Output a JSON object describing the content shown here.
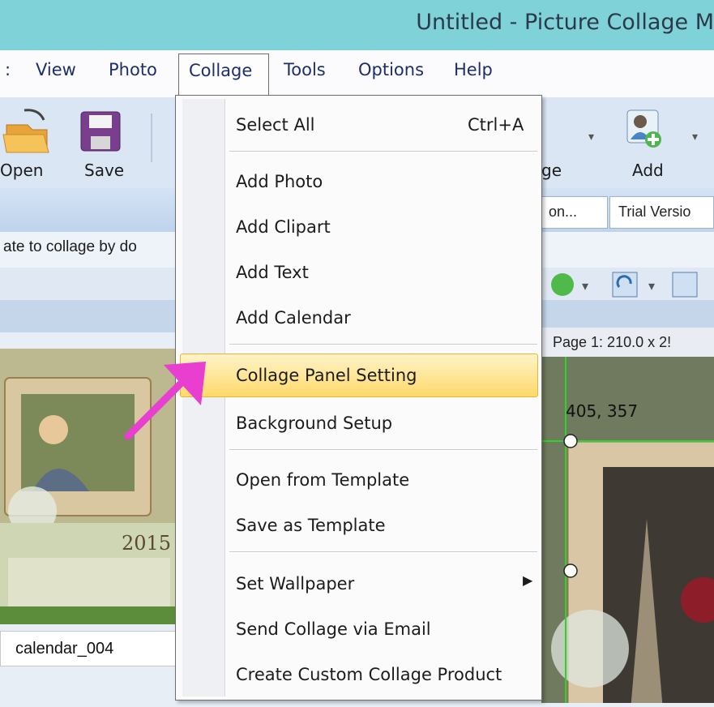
{
  "window": {
    "title": "Untitled - Picture Collage M"
  },
  "menubar": {
    "items": [
      ":",
      "View",
      "Photo",
      "Collage",
      "Tools",
      "Options",
      "Help"
    ]
  },
  "toolbar": {
    "open": "Open",
    "save": "Save",
    "change": "ge",
    "add": "Add"
  },
  "bar2": {
    "option": "on...",
    "trial": "Trial Versio"
  },
  "hint": "ate to collage by do",
  "page_info": "Page 1: 210.0 x 2!",
  "coords": "405, 357",
  "thumbnail": {
    "year": "2015",
    "caption": "calendar_004"
  },
  "collage_menu": {
    "select_all": "Select All",
    "select_all_shortcut": "Ctrl+A",
    "add_photo": "Add Photo",
    "add_clipart": "Add Clipart",
    "add_text": "Add Text",
    "add_calendar": "Add Calendar",
    "panel_setting": "Collage Panel Setting",
    "background_setup": "Background Setup",
    "open_template": "Open from Template",
    "save_template": "Save as Template",
    "set_wallpaper": "Set Wallpaper",
    "send_email": "Send Collage via Email",
    "create_product": "Create Custom Collage Product"
  },
  "colors": {
    "titlebar": "#7fd3d8",
    "highlight": "#ffd96a",
    "arrow": "#e83fd0"
  }
}
